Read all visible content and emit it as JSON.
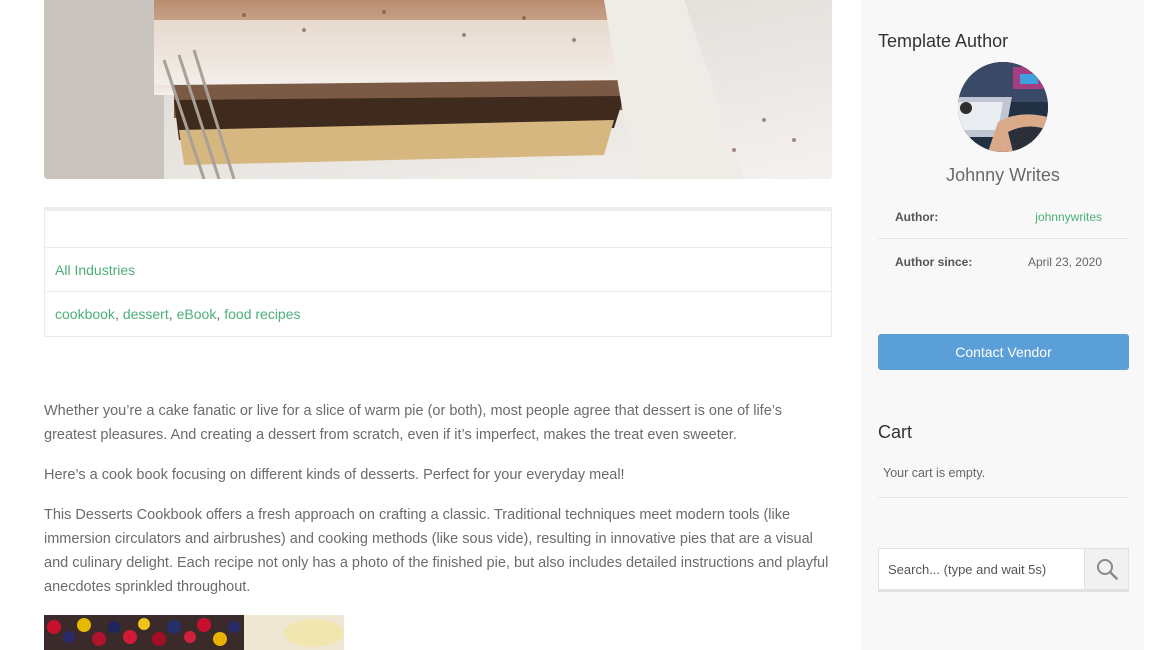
{
  "product": {
    "meta": {
      "category": "All Industries",
      "tags": [
        "cookbook",
        "dessert",
        "eBook",
        "food recipes"
      ],
      "tag_separator": ","
    },
    "description": [
      "Whether you’re a cake fanatic or live for a slice of warm pie (or both), most people agree that dessert is one of life’s greatest pleasures. And creating a dessert from scratch, even if it’s imperfect, makes the treat even sweeter.",
      "Here’s a cook book focusing on different kinds of desserts. Perfect for your everyday meal!",
      "This Desserts Cookbook offers a fresh approach on crafting a classic. Traditional techniques meet modern tools (like immersion circulators and airbrushes) and cooking methods (like sous vide), resulting in innovative pies that are a visual and culinary delight. Each recipe not only has a photo of the finished pie, but also includes detailed instructions and playful anecdotes sprinkled throughout."
    ]
  },
  "sidebar": {
    "author_widget": {
      "title": "Template Author",
      "name": "Johnny Writes",
      "author_label": "Author:",
      "author_value": "johnnywrites",
      "since_label": "Author since:",
      "since_value": "April 23, 2020",
      "contact_button": "Contact Vendor"
    },
    "cart_widget": {
      "title": "Cart",
      "empty_text": "Your cart is empty."
    },
    "search": {
      "placeholder": "Search... (type and wait 5s)",
      "icon": "search-icon"
    }
  },
  "colors": {
    "link": "#4caf7a",
    "button": "#5b9fd9",
    "sidebar_bg": "#f8f8f8"
  }
}
